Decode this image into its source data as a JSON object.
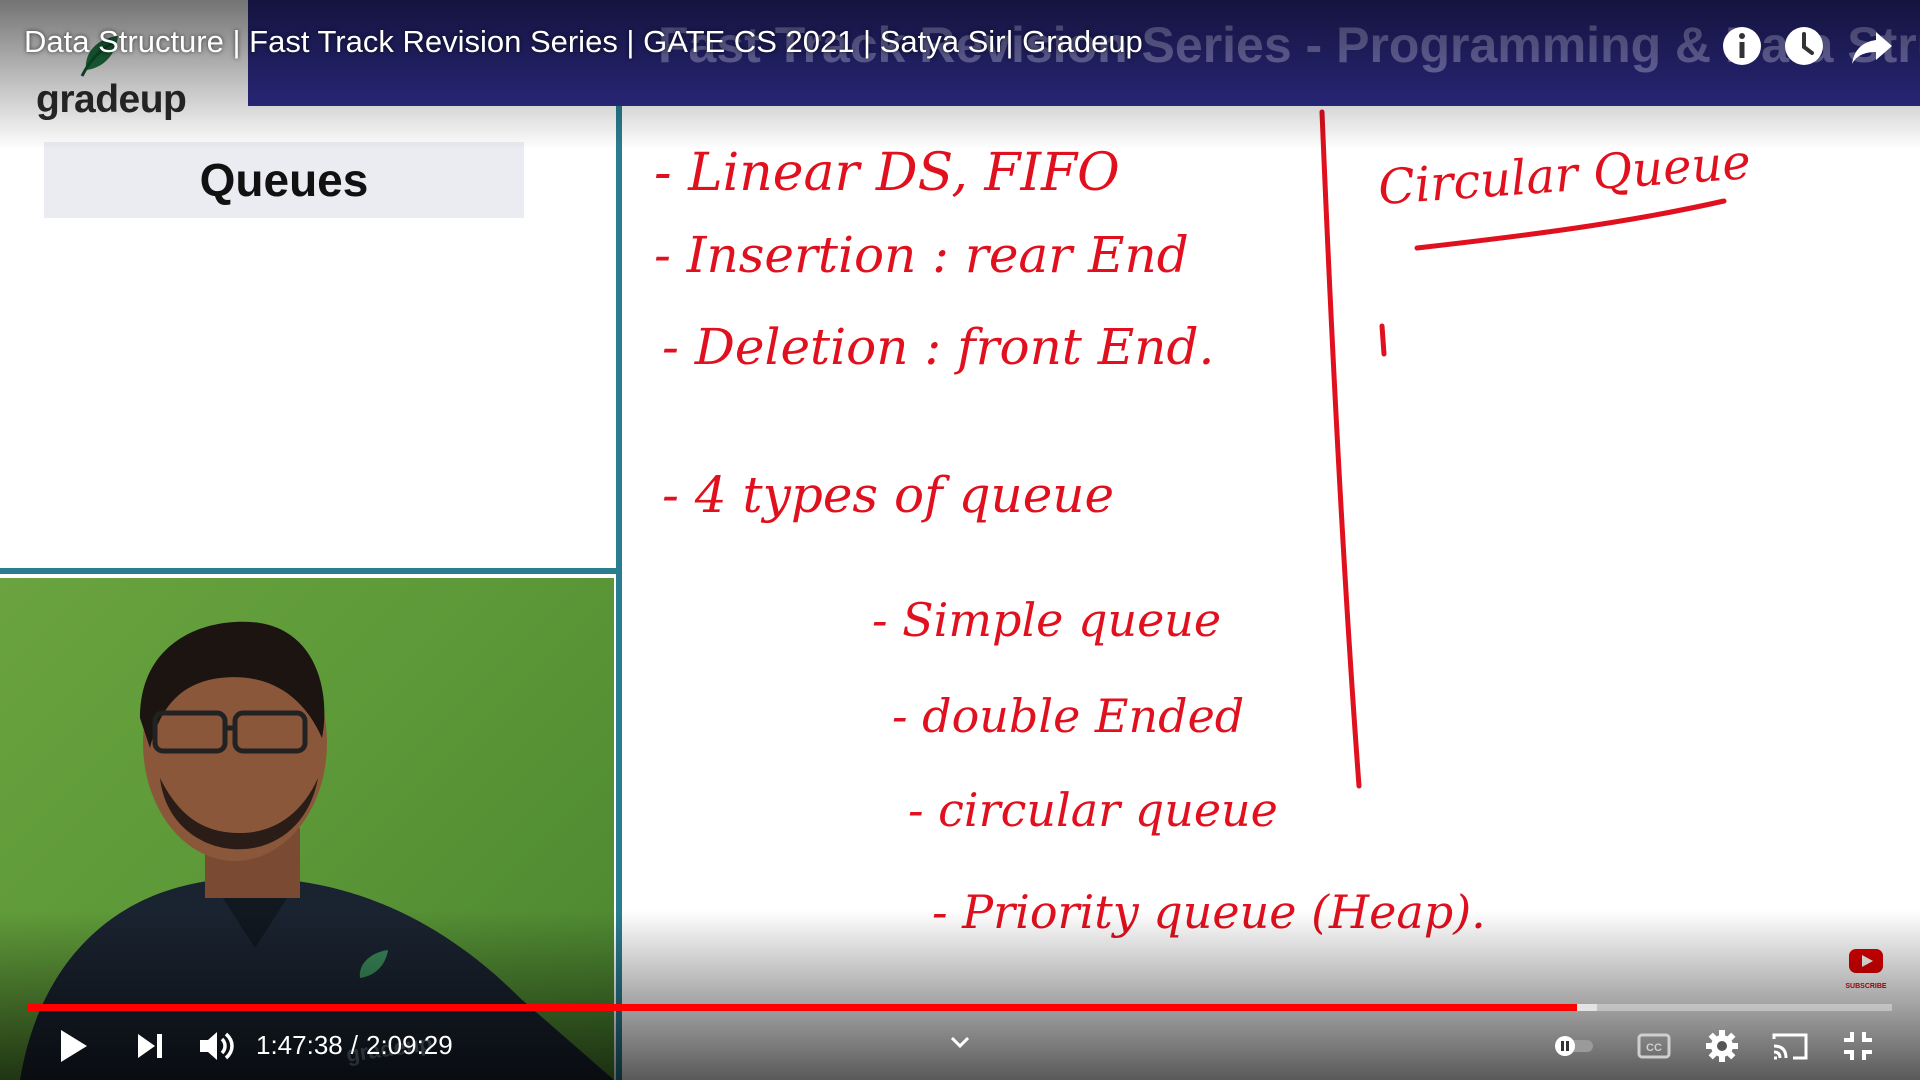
{
  "player": {
    "video_title": "Data Structure | Fast Track Revision Series | GATE CS 2021 | Satya Sir| Gradeup",
    "current_time": "1:47:38",
    "separator": "/",
    "duration": "2:09:29",
    "progress_fraction": 0.8312,
    "buffered_fraction": 0.842,
    "accent_color": "#ff0000"
  },
  "slide": {
    "banner_text": "Fast Track Revision Series - Programming & Data Structures",
    "logo_text": "gradeup",
    "topic_title": "Queues",
    "watermark_text": "gradeup",
    "subscribe_text": "SUBSCRIBE"
  },
  "whiteboard": {
    "ink_color": "#e0101e",
    "lines": [
      "- Linear DS,  FIFO",
      "- Insertion :  rear End",
      "- Deletion :  front End.",
      "- 4 types of queue",
      "- Simple queue",
      "- double Ended",
      "- circular queue",
      "- Priority queue (Heap)."
    ],
    "right_heading": "Circular Queue"
  },
  "icons": {
    "info": "info-icon",
    "watch_later": "clock-icon",
    "share": "share-icon",
    "play": "play-icon",
    "next": "next-icon",
    "volume": "volume-icon",
    "autoplay": "autoplay-toggle-icon",
    "captions": "captions-icon",
    "settings": "gear-icon",
    "cast": "cast-icon",
    "exit_fullscreen": "exit-fullscreen-icon",
    "expand": "chevron-down-icon"
  }
}
